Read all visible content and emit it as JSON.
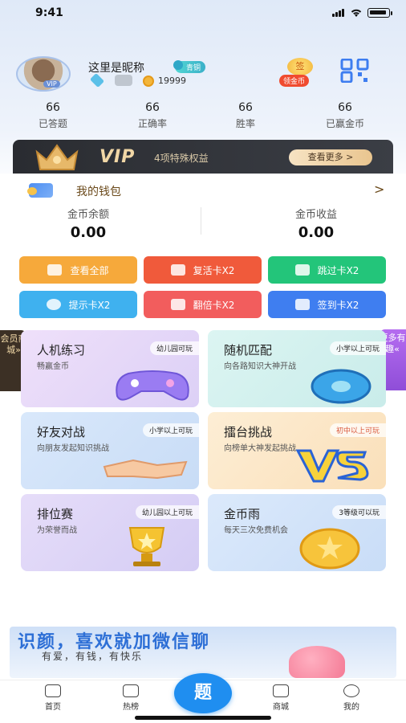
{
  "status": {
    "time": "9:41"
  },
  "profile": {
    "nickname": "这里是昵称",
    "avatar_badge": "VIP",
    "level": "青铜",
    "coins": "19999",
    "signin_coin": "签",
    "signin_label": "领金币"
  },
  "stats": [
    {
      "value": "66",
      "label": "已答题"
    },
    {
      "value": "66",
      "label": "正确率"
    },
    {
      "value": "66",
      "label": "胜率"
    },
    {
      "value": "66",
      "label": "已赢金币"
    }
  ],
  "vip": {
    "title": "VIP",
    "subtitle": "4项特殊权益",
    "button": "查看更多 >"
  },
  "wallet": {
    "title": "我的钱包",
    "arrow": ">",
    "balance_label": "金币余额",
    "balance_value": "0.00",
    "earnings_label": "金币收益",
    "earnings_value": "0.00"
  },
  "actions": [
    {
      "label": "查看全部",
      "color": "#f6a93b"
    },
    {
      "label": "复活卡X2",
      "color": "#f05a3b"
    },
    {
      "label": "跳过卡X2",
      "color": "#23c57a"
    },
    {
      "label": "提示卡X2",
      "color": "#3fb1ef"
    },
    {
      "label": "翻倍卡X2",
      "color": "#f25d5d"
    },
    {
      "label": "签到卡X2",
      "color": "#3f7ef0"
    }
  ],
  "side": {
    "left": "会员商城»",
    "right": "更多有趣«"
  },
  "modes": [
    {
      "title": "人机练习",
      "tag": "幼儿园可玩",
      "sub": "畅赢金币",
      "bg": "#ead9f7"
    },
    {
      "title": "随机匹配",
      "tag": "小学以上可玩",
      "sub": "向各路知识大神开战",
      "bg": "#d6f1ef"
    },
    {
      "title": "好友对战",
      "tag": "小学以上可玩",
      "sub": "向朋友发起知识挑战",
      "bg": "#d5e6f8"
    },
    {
      "title": "擂台挑战",
      "tag": "初中以上可玩",
      "sub": "向榜单大神发起挑战",
      "bg": "#fbe7cb"
    },
    {
      "title": "排位赛",
      "tag": "幼儿园以上可玩",
      "sub": "为荣誉而战",
      "bg": "#e3dbf7"
    },
    {
      "title": "金币雨",
      "tag": "3等级可以玩",
      "sub": "每天三次免费机会",
      "bg": "#d6e7f9"
    }
  ],
  "ad": {
    "title": "识颜，喜欢就加微信聊",
    "sub": "有爱，有钱，有快乐"
  },
  "nav": [
    {
      "label": "首页"
    },
    {
      "label": "热榜"
    },
    {
      "label": "题"
    },
    {
      "label": "商城"
    },
    {
      "label": "我的"
    }
  ]
}
